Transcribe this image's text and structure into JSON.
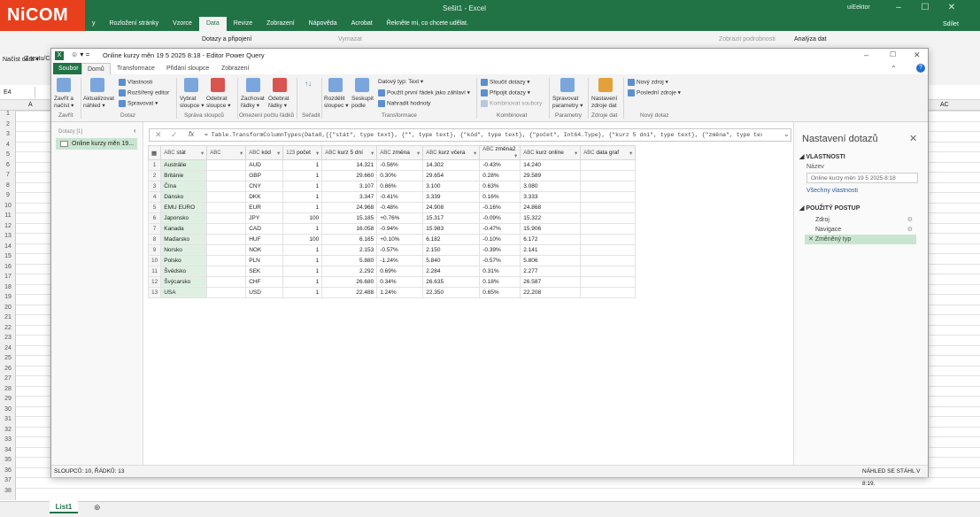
{
  "excel": {
    "logo": "NiCOM",
    "title": "Sešit1 - Excel",
    "user": "uiEektor",
    "tabs": [
      "y",
      "Rozložení stránky",
      "Vzorce",
      "Data",
      "Revize",
      "Zobrazení",
      "Nápověda",
      "Acrobat",
      "Řekněte mi, co chcete udělat."
    ],
    "share": "Sdílet",
    "ribbon_left": [
      "Načíst data ▾",
      "Z textu/CSV"
    ],
    "ribbon_items": [
      "Dotazy a připojení",
      "Vymazat",
      "Zobrazit podrobnosti",
      "Analýza dat"
    ],
    "name_box": "E4",
    "col_a": "A",
    "col_ac": "AC",
    "rows": [
      "1",
      "2",
      "3",
      "4",
      "5",
      "6",
      "7",
      "8",
      "9",
      "10",
      "11",
      "12",
      "13",
      "14",
      "15",
      "16",
      "17",
      "18",
      "19",
      "20",
      "21",
      "22",
      "23",
      "24",
      "25",
      "26",
      "27",
      "28",
      "29",
      "30",
      "31",
      "32",
      "33",
      "34",
      "35",
      "36",
      "37",
      "38"
    ],
    "sheet_tab": "List1"
  },
  "pq": {
    "title": "Online kurzy měn 19 5 2025 8:18 - Editor Power Query",
    "tabs": [
      "Soubor",
      "Domů",
      "Transformace",
      "Přidání sloupce",
      "Zobrazení"
    ],
    "ribbon": {
      "close_apply": "Zavřít a načíst ▾",
      "refresh": "Aktualizovat náhled ▾",
      "properties": "Vlastnosti",
      "adv_editor": "Rozšířený editor",
      "manage": "Spravovat ▾",
      "choose_cols": "Vybrat sloupce ▾",
      "remove_cols": "Odebrat sloupce ▾",
      "keep_rows": "Zachovat řádky ▾",
      "remove_rows": "Odebrat řádky ▾",
      "split": "Rozdělit sloupec ▾",
      "group": "Seskupit podle",
      "datatype": "Datový typ: Text ▾",
      "first_row": "Použít první řádek jako záhlaví ▾",
      "replace": "Nahradit hodnoty",
      "merge": "Sloučit dotazy ▾",
      "append": "Připojit dotazy ▾",
      "combine": "Kombinovat soubory",
      "params": "Spravovat parametry ▾",
      "sources": "Nastavení zdroje dat",
      "new_source": "Nový zdroj ▾",
      "recent": "Poslední zdroje ▾",
      "groups": [
        "Zavřít",
        "Dotaz",
        "Správa sloupců",
        "Omezení počtu řádků",
        "Seřadit",
        "Transformace",
        "Kombinovat",
        "Parametry",
        "Zdroje dat",
        "Nový dotaz"
      ]
    },
    "queries_head": "Dotazy [1]",
    "query_item": "Online kurzy měn 19...",
    "formula": "= Table.TransformColumnTypes(Data0,{{\"stát\", type text}, {\"\", type text}, {\"kód\", type text}, {\"počet\", Int64.Type}, {\"kurz 5 dní\", type text}, {\"změna\", type text},",
    "columns": [
      "stát",
      "",
      "kód",
      "počet",
      "kurz 5 dní",
      "změna",
      "kurz včera",
      "změna2",
      "kurz online",
      "data graf"
    ],
    "column_types": [
      "ABC",
      "ABC",
      "ABC",
      "123",
      "ABC",
      "ABC",
      "ABC",
      "ABC",
      "ABC",
      "ABC"
    ],
    "rows": [
      [
        "Austrálie",
        "",
        "AUD",
        "1",
        "14.321",
        "-0.56%",
        "14.302",
        "-0.43%",
        "14.240",
        ""
      ],
      [
        "Británie",
        "",
        "GBP",
        "1",
        "29.660",
        "0.30%",
        "29.654",
        "0.28%",
        "29.589",
        ""
      ],
      [
        "Čína",
        "",
        "CNY",
        "1",
        "3.107",
        "0.86%",
        "3.100",
        "0.63%",
        "3.080",
        ""
      ],
      [
        "Dánsko",
        "",
        "DKK",
        "1",
        "3.347",
        "-0.41%",
        "3.339",
        "0.16%",
        "3.333",
        ""
      ],
      [
        "EMU EURO",
        "",
        "EUR",
        "1",
        "24.968",
        "-0.48%",
        "24.908",
        "-0.16%",
        "24.868",
        ""
      ],
      [
        "Japonsko",
        "",
        "JPY",
        "100",
        "15.185",
        "+0.76%",
        "15.317",
        "-0.09%",
        "15.322",
        ""
      ],
      [
        "Kanada",
        "",
        "CAD",
        "1",
        "16.058",
        "-0.94%",
        "15.983",
        "-0.47%",
        "15.906",
        ""
      ],
      [
        "Maďarsko",
        "",
        "HUF",
        "100",
        "6.165",
        "+0.10%",
        "6.182",
        "-0.10%",
        "6.172",
        ""
      ],
      [
        "Norsko",
        "",
        "NOK",
        "1",
        "2.153",
        "-0.57%",
        "2.150",
        "-0.39%",
        "2.141",
        ""
      ],
      [
        "Polsko",
        "",
        "PLN",
        "1",
        "5.880",
        "-1.24%",
        "5.840",
        "-0.57%",
        "5.806",
        ""
      ],
      [
        "Švédsko",
        "",
        "SEK",
        "1",
        "2.292",
        "0.69%",
        "2.284",
        "0.31%",
        "2.277",
        ""
      ],
      [
        "Švýcarsko",
        "",
        "CHF",
        "1",
        "26.680",
        "0.34%",
        "26.635",
        "0.18%",
        "26.587",
        ""
      ],
      [
        "USA",
        "",
        "USD",
        "1",
        "22.488",
        "1.24%",
        "22.350",
        "0.65%",
        "22.208",
        ""
      ]
    ],
    "settings": {
      "title": "Nastavení dotazů",
      "props_head": "◢ VLASTNOSTI",
      "name_label": "Název",
      "name_value": "Online kurzy měn 19 5 2025 8:18",
      "all_props": "Všechny vlastnosti",
      "steps_head": "◢ POUŽITÝ POSTUP",
      "steps": [
        "Zdroj",
        "Navigace",
        "Změněný typ"
      ]
    },
    "status_left": "SLOUPCŮ: 10, ŘÁDKŮ: 13",
    "status_right": "NÁHLED SE STÁHL V 8:19."
  }
}
